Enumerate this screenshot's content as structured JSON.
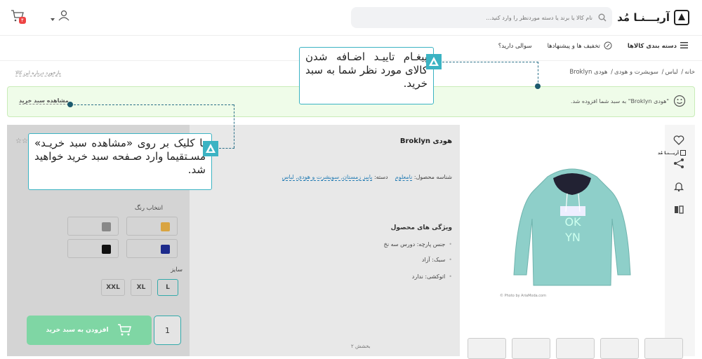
{
  "header": {
    "logo_text": "آریـــنـا مُد",
    "search_placeholder": "نام کالا یا برند یا دسته موردنظر را وارد کنید...",
    "cart_count": "۴"
  },
  "nav": {
    "categories": "دسته بندی کالاها",
    "deals": "تخفیف ها و پیشنهادها",
    "faq": "سوالی دارید؟"
  },
  "breadcrumb": {
    "items": [
      "خانه",
      "لباس",
      "سویشرت و هودی",
      "هودی Broklyn"
    ]
  },
  "report_link": "بازخورد درباره این کالا",
  "banner": {
    "message": "\"هودی Broklyn\" به سبد شما افزوده شد.",
    "view_cart": "مشاهده سبد خرید"
  },
  "product": {
    "title": "هودی Broklyn",
    "id_label": "شناسه محصول:",
    "id_value": "نامعلوم",
    "category_label": "دسته:",
    "categories": "پاییز زمستان, سویشرت و هودی, لباس",
    "features_title": "ویژگی های محصول",
    "features": [
      "جنس پارچه: دورس سه نخ",
      "سبک: آزاد",
      "اتوکشی: ندارد"
    ],
    "pager": "بخشش ۲",
    "image_credit": "© Photo by AriaModa.com"
  },
  "purchase": {
    "color_label": "انتخاب رنگ",
    "colors": [
      {
        "name": "mustard",
        "hex": "#d9a441"
      },
      {
        "name": "gray",
        "hex": "#888888"
      },
      {
        "name": "navy",
        "hex": "#1d2b8c"
      },
      {
        "name": "black",
        "hex": "#111111"
      }
    ],
    "size_label": "سایز",
    "sizes": [
      "L",
      "XL",
      "XXL"
    ],
    "selected_size": "L",
    "add_to_cart": "افزودن به سبد خرید",
    "quantity": "1"
  },
  "callouts": {
    "top": "پیغـام تاییـد اضـافه شدن کالای مورد نظر شما به سبد خرید.",
    "left": "با کلیک بر روی «مشاهده سبد خریـد» مسـتقیما وارد صـفحه سبد خرید خواهید شد."
  },
  "colors": {
    "accent": "#3bb3c3",
    "success_bg": "#effce9",
    "add_button": "#7fd6a4"
  }
}
